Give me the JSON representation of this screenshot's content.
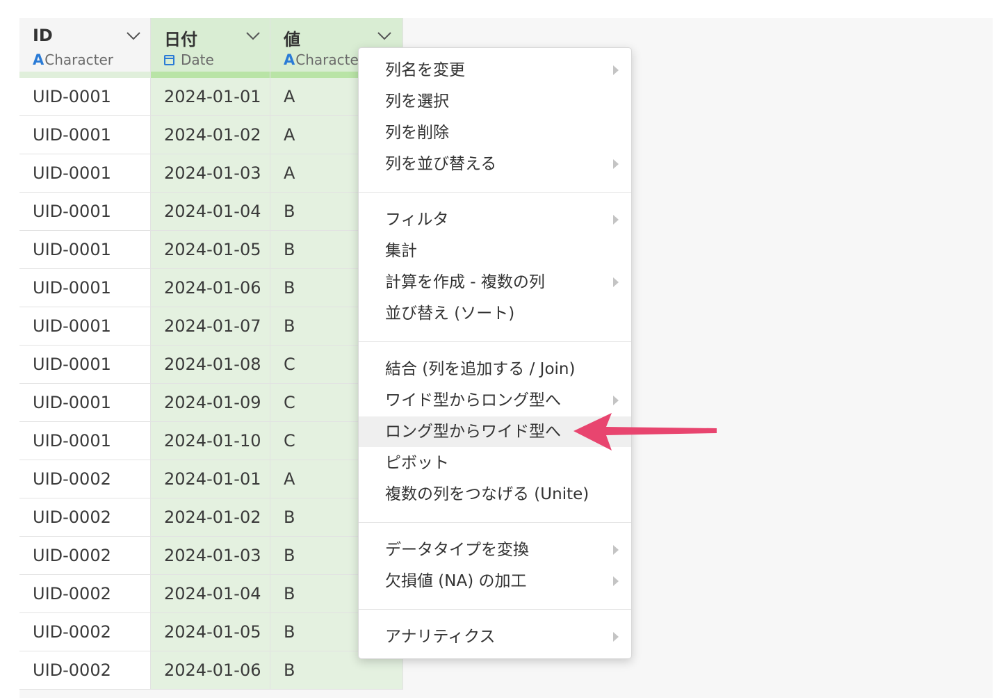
{
  "columns": [
    {
      "name": "ID",
      "type_glyph": "A",
      "type": "Character"
    },
    {
      "name": "日付",
      "type_glyph": "",
      "type": "Date"
    },
    {
      "name": "値",
      "type_glyph": "A",
      "type": "Characte"
    }
  ],
  "rows": [
    [
      "UID-0001",
      "2024-01-01",
      "A"
    ],
    [
      "UID-0001",
      "2024-01-02",
      "A"
    ],
    [
      "UID-0001",
      "2024-01-03",
      "A"
    ],
    [
      "UID-0001",
      "2024-01-04",
      "B"
    ],
    [
      "UID-0001",
      "2024-01-05",
      "B"
    ],
    [
      "UID-0001",
      "2024-01-06",
      "B"
    ],
    [
      "UID-0001",
      "2024-01-07",
      "B"
    ],
    [
      "UID-0001",
      "2024-01-08",
      "C"
    ],
    [
      "UID-0001",
      "2024-01-09",
      "C"
    ],
    [
      "UID-0001",
      "2024-01-10",
      "C"
    ],
    [
      "UID-0002",
      "2024-01-01",
      "A"
    ],
    [
      "UID-0002",
      "2024-01-02",
      "B"
    ],
    [
      "UID-0002",
      "2024-01-03",
      "B"
    ],
    [
      "UID-0002",
      "2024-01-04",
      "B"
    ],
    [
      "UID-0002",
      "2024-01-05",
      "B"
    ],
    [
      "UID-0002",
      "2024-01-06",
      "B"
    ]
  ],
  "menu": {
    "items": [
      {
        "label": "列名を変更",
        "submenu": true
      },
      {
        "label": "列を選択",
        "submenu": false
      },
      {
        "label": "列を削除",
        "submenu": false
      },
      {
        "label": "列を並び替える",
        "submenu": true
      },
      {
        "label": "フィルタ",
        "submenu": true
      },
      {
        "label": "集計",
        "submenu": false
      },
      {
        "label": "計算を作成 - 複数の列",
        "submenu": true
      },
      {
        "label": "並び替え (ソート)",
        "submenu": false
      },
      {
        "label": "結合 (列を追加する / Join)",
        "submenu": false
      },
      {
        "label": "ワイド型からロング型へ",
        "submenu": true
      },
      {
        "label": "ロング型からワイド型へ",
        "submenu": false,
        "highlighted": true
      },
      {
        "label": "ピボット",
        "submenu": false
      },
      {
        "label": "複数の列をつなげる (Unite)",
        "submenu": false
      },
      {
        "label": "データタイプを変換",
        "submenu": true
      },
      {
        "label": "欠損値 (NA) の加工",
        "submenu": true
      },
      {
        "label": "アナリティクス",
        "submenu": true
      }
    ]
  },
  "icons": {
    "type_character": "letter-a-icon",
    "type_date": "calendar-icon",
    "column_menu": "chevron-down-icon",
    "submenu": "triangle-right-icon",
    "annotation": "arrow-left-icon"
  },
  "colors": {
    "selected_column_bg": "#e4f1e0",
    "selected_header_bg": "#d9edd3",
    "selected_bar": "#b9e4a6",
    "type_icon": "#2a7bd6",
    "annotation_arrow": "#e8456f"
  }
}
